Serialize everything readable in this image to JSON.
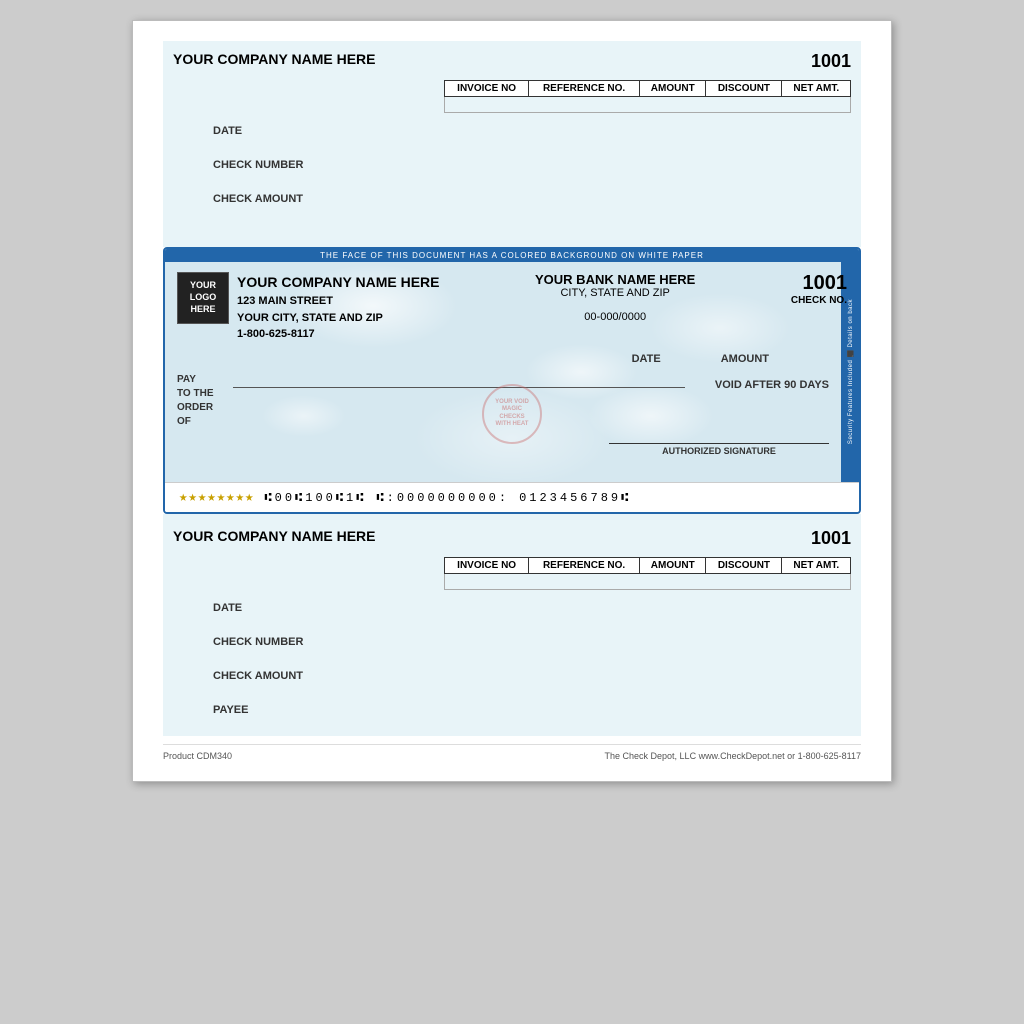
{
  "page": {
    "background": "#ccc"
  },
  "top_stub": {
    "company_name": "YOUR COMPANY NAME HERE",
    "check_number": "1001",
    "table_headers": [
      "INVOICE NO",
      "REFERENCE NO.",
      "AMOUNT",
      "DISCOUNT",
      "NET AMT."
    ],
    "fields": [
      {
        "label": "DATE"
      },
      {
        "label": "CHECK NUMBER"
      },
      {
        "label": "CHECK AMOUNT"
      }
    ]
  },
  "check": {
    "security_banner": "THE FACE OF THIS DOCUMENT HAS A COLORED BACKGROUND ON WHITE PAPER",
    "logo_text": "YOUR\nLOGO\nHERE",
    "company_name": "YOUR COMPANY NAME HERE",
    "company_address1": "123 MAIN STREET",
    "company_address2": "YOUR CITY, STATE AND ZIP",
    "company_phone": "1-800-625-8117",
    "bank_name": "YOUR BANK NAME HERE",
    "bank_address": "CITY, STATE AND ZIP",
    "routing_number": "00-000/0000",
    "check_number": "1001",
    "check_no_label": "CHECK NO.",
    "date_label": "DATE",
    "amount_label": "AMOUNT",
    "pay_to_label": "PAY\nTO THE\nORDER\nOF",
    "void_label": "VOID AFTER 90 DAYS",
    "signature_label": "AUTHORIZED SIGNATURE",
    "micr_stars": "★ ★ ★ ★ ★ ★ ★ ★",
    "micr_routing": "⑆00⑆100⑆1⑆",
    "micr_account": "⑆:0000000000:",
    "micr_check": "0123456789⑆",
    "security_strip_text": "Security Features Included  Details on back",
    "watermark_text": "YOUR VOID MAGIC CHECKS WITH HEAT"
  },
  "bottom_stub": {
    "company_name": "YOUR COMPANY NAME HERE",
    "check_number": "1001",
    "table_headers": [
      "INVOICE NO",
      "REFERENCE NO.",
      "AMOUNT",
      "DISCOUNT",
      "NET AMT."
    ],
    "fields": [
      {
        "label": "DATE"
      },
      {
        "label": "CHECK NUMBER"
      },
      {
        "label": "CHECK AMOUNT"
      }
    ],
    "payee_label": "PAYEE"
  },
  "footer": {
    "product_code": "Product CDM340",
    "company_info": "The Check Depot, LLC  www.CheckDepot.net  or  1-800-625-8117"
  }
}
